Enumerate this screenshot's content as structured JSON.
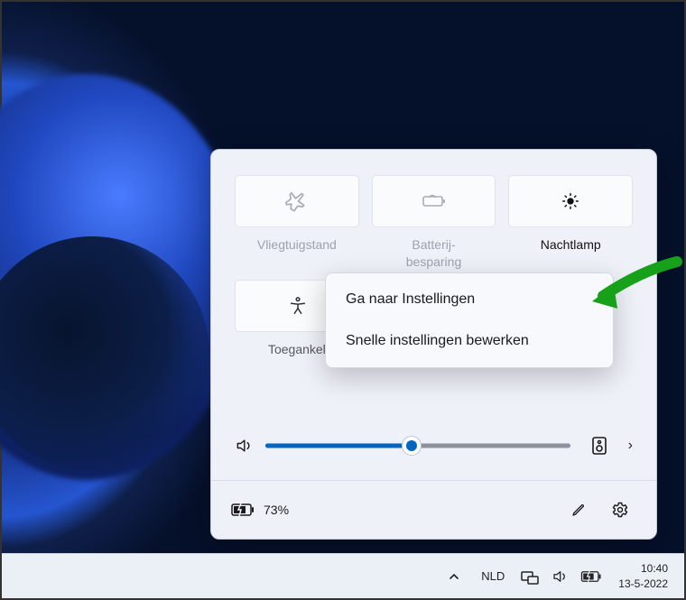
{
  "quickSettings": {
    "tiles": {
      "airplane": {
        "label": "Vliegtuigstand"
      },
      "batterySaver": {
        "label": "Batterij-\nbesparing"
      },
      "nightLight": {
        "label": "Nachtlamp"
      },
      "accessibility": {
        "label": "Toegankelij"
      }
    },
    "contextMenu": {
      "goToSettings": "Ga naar Instellingen",
      "editQuickSettings": "Snelle instellingen bewerken"
    },
    "volume": {
      "percent": 48
    },
    "footer": {
      "batteryPercent": "73%"
    }
  },
  "taskbar": {
    "language": "NLD",
    "clock": {
      "time": "10:40",
      "date": "13-5-2022"
    }
  }
}
